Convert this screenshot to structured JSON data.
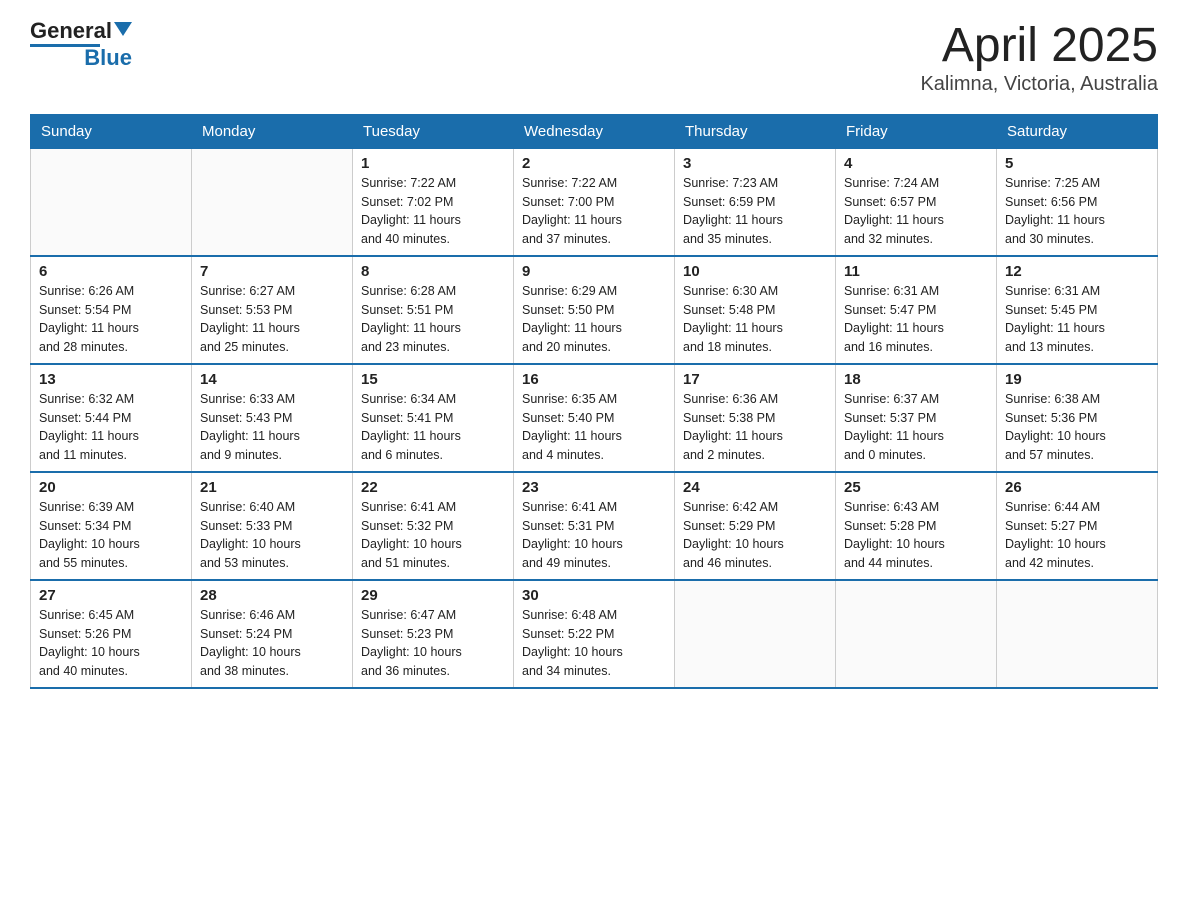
{
  "logo": {
    "general": "General",
    "blue": "Blue"
  },
  "title": "April 2025",
  "subtitle": "Kalimna, Victoria, Australia",
  "days_of_week": [
    "Sunday",
    "Monday",
    "Tuesday",
    "Wednesday",
    "Thursday",
    "Friday",
    "Saturday"
  ],
  "weeks": [
    [
      {
        "day": "",
        "info": ""
      },
      {
        "day": "",
        "info": ""
      },
      {
        "day": "1",
        "info": "Sunrise: 7:22 AM\nSunset: 7:02 PM\nDaylight: 11 hours\nand 40 minutes."
      },
      {
        "day": "2",
        "info": "Sunrise: 7:22 AM\nSunset: 7:00 PM\nDaylight: 11 hours\nand 37 minutes."
      },
      {
        "day": "3",
        "info": "Sunrise: 7:23 AM\nSunset: 6:59 PM\nDaylight: 11 hours\nand 35 minutes."
      },
      {
        "day": "4",
        "info": "Sunrise: 7:24 AM\nSunset: 6:57 PM\nDaylight: 11 hours\nand 32 minutes."
      },
      {
        "day": "5",
        "info": "Sunrise: 7:25 AM\nSunset: 6:56 PM\nDaylight: 11 hours\nand 30 minutes."
      }
    ],
    [
      {
        "day": "6",
        "info": "Sunrise: 6:26 AM\nSunset: 5:54 PM\nDaylight: 11 hours\nand 28 minutes."
      },
      {
        "day": "7",
        "info": "Sunrise: 6:27 AM\nSunset: 5:53 PM\nDaylight: 11 hours\nand 25 minutes."
      },
      {
        "day": "8",
        "info": "Sunrise: 6:28 AM\nSunset: 5:51 PM\nDaylight: 11 hours\nand 23 minutes."
      },
      {
        "day": "9",
        "info": "Sunrise: 6:29 AM\nSunset: 5:50 PM\nDaylight: 11 hours\nand 20 minutes."
      },
      {
        "day": "10",
        "info": "Sunrise: 6:30 AM\nSunset: 5:48 PM\nDaylight: 11 hours\nand 18 minutes."
      },
      {
        "day": "11",
        "info": "Sunrise: 6:31 AM\nSunset: 5:47 PM\nDaylight: 11 hours\nand 16 minutes."
      },
      {
        "day": "12",
        "info": "Sunrise: 6:31 AM\nSunset: 5:45 PM\nDaylight: 11 hours\nand 13 minutes."
      }
    ],
    [
      {
        "day": "13",
        "info": "Sunrise: 6:32 AM\nSunset: 5:44 PM\nDaylight: 11 hours\nand 11 minutes."
      },
      {
        "day": "14",
        "info": "Sunrise: 6:33 AM\nSunset: 5:43 PM\nDaylight: 11 hours\nand 9 minutes."
      },
      {
        "day": "15",
        "info": "Sunrise: 6:34 AM\nSunset: 5:41 PM\nDaylight: 11 hours\nand 6 minutes."
      },
      {
        "day": "16",
        "info": "Sunrise: 6:35 AM\nSunset: 5:40 PM\nDaylight: 11 hours\nand 4 minutes."
      },
      {
        "day": "17",
        "info": "Sunrise: 6:36 AM\nSunset: 5:38 PM\nDaylight: 11 hours\nand 2 minutes."
      },
      {
        "day": "18",
        "info": "Sunrise: 6:37 AM\nSunset: 5:37 PM\nDaylight: 11 hours\nand 0 minutes."
      },
      {
        "day": "19",
        "info": "Sunrise: 6:38 AM\nSunset: 5:36 PM\nDaylight: 10 hours\nand 57 minutes."
      }
    ],
    [
      {
        "day": "20",
        "info": "Sunrise: 6:39 AM\nSunset: 5:34 PM\nDaylight: 10 hours\nand 55 minutes."
      },
      {
        "day": "21",
        "info": "Sunrise: 6:40 AM\nSunset: 5:33 PM\nDaylight: 10 hours\nand 53 minutes."
      },
      {
        "day": "22",
        "info": "Sunrise: 6:41 AM\nSunset: 5:32 PM\nDaylight: 10 hours\nand 51 minutes."
      },
      {
        "day": "23",
        "info": "Sunrise: 6:41 AM\nSunset: 5:31 PM\nDaylight: 10 hours\nand 49 minutes."
      },
      {
        "day": "24",
        "info": "Sunrise: 6:42 AM\nSunset: 5:29 PM\nDaylight: 10 hours\nand 46 minutes."
      },
      {
        "day": "25",
        "info": "Sunrise: 6:43 AM\nSunset: 5:28 PM\nDaylight: 10 hours\nand 44 minutes."
      },
      {
        "day": "26",
        "info": "Sunrise: 6:44 AM\nSunset: 5:27 PM\nDaylight: 10 hours\nand 42 minutes."
      }
    ],
    [
      {
        "day": "27",
        "info": "Sunrise: 6:45 AM\nSunset: 5:26 PM\nDaylight: 10 hours\nand 40 minutes."
      },
      {
        "day": "28",
        "info": "Sunrise: 6:46 AM\nSunset: 5:24 PM\nDaylight: 10 hours\nand 38 minutes."
      },
      {
        "day": "29",
        "info": "Sunrise: 6:47 AM\nSunset: 5:23 PM\nDaylight: 10 hours\nand 36 minutes."
      },
      {
        "day": "30",
        "info": "Sunrise: 6:48 AM\nSunset: 5:22 PM\nDaylight: 10 hours\nand 34 minutes."
      },
      {
        "day": "",
        "info": ""
      },
      {
        "day": "",
        "info": ""
      },
      {
        "day": "",
        "info": ""
      }
    ]
  ]
}
